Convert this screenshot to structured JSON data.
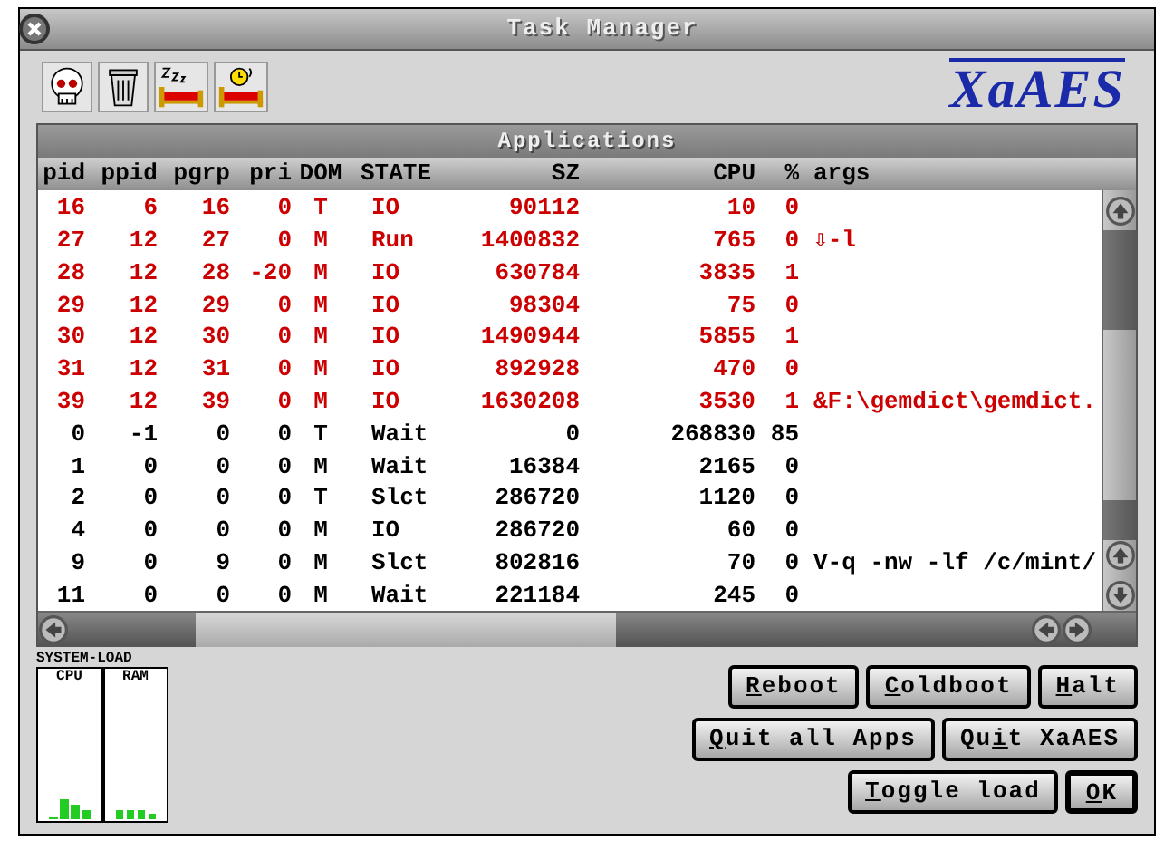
{
  "window": {
    "title": "Task Manager"
  },
  "logo": "XaAES",
  "panel": {
    "title": "Applications",
    "columns": [
      "pid",
      "ppid",
      "pgrp",
      "pri",
      "DOM",
      "STATE",
      "SZ",
      "CPU",
      "%",
      "args"
    ],
    "rows": [
      {
        "color": "#cc0000",
        "pid": "16",
        "ppid": "6",
        "pgrp": "16",
        "pri": "0",
        "dom": "T",
        "state": "IO",
        "sz": "90112",
        "cpu": "10",
        "pct": "0"
      },
      {
        "color": "#cc0000",
        "pid": "27",
        "ppid": "12",
        "pgrp": "27",
        "pri": "0",
        "dom": "M",
        "state": "Run",
        "sz": "1400832",
        "cpu": "765",
        "pct": "0",
        "args": "⇩-l"
      },
      {
        "color": "#cc0000",
        "pid": "28",
        "ppid": "12",
        "pgrp": "28",
        "pri": "-20",
        "dom": "M",
        "state": "IO",
        "sz": "630784",
        "cpu": "3835",
        "pct": "1"
      },
      {
        "color": "#cc0000",
        "pid": "29",
        "ppid": "12",
        "pgrp": "29",
        "pri": "0",
        "dom": "M",
        "state": "IO",
        "sz": "98304",
        "cpu": "75",
        "pct": "0"
      },
      {
        "color": "#cc0000",
        "pid": "30",
        "ppid": "12",
        "pgrp": "30",
        "pri": "0",
        "dom": "M",
        "state": "IO",
        "sz": "1490944",
        "cpu": "5855",
        "pct": "1"
      },
      {
        "color": "#cc0000",
        "pid": "31",
        "ppid": "12",
        "pgrp": "31",
        "pri": "0",
        "dom": "M",
        "state": "IO",
        "sz": "892928",
        "cpu": "470",
        "pct": "0"
      },
      {
        "color": "#cc0000",
        "pid": "39",
        "ppid": "12",
        "pgrp": "39",
        "pri": "0",
        "dom": "M",
        "state": "IO",
        "sz": "1630208",
        "cpu": "3530",
        "pct": "1",
        "args": "&F:\\gemdict\\gemdict."
      },
      {
        "color": "#000000",
        "pid": "0",
        "ppid": "-1",
        "pgrp": "0",
        "pri": "0",
        "dom": "T",
        "state": "Wait",
        "sz": "0",
        "cpu": "268830",
        "pct": "85"
      },
      {
        "color": "#000000",
        "pid": "1",
        "ppid": "0",
        "pgrp": "0",
        "pri": "0",
        "dom": "M",
        "state": "Wait",
        "sz": "16384",
        "cpu": "2165",
        "pct": "0"
      },
      {
        "color": "#000000",
        "pid": "2",
        "ppid": "0",
        "pgrp": "0",
        "pri": "0",
        "dom": "T",
        "state": "Slct",
        "sz": "286720",
        "cpu": "1120",
        "pct": "0"
      },
      {
        "color": "#000000",
        "pid": "4",
        "ppid": "0",
        "pgrp": "0",
        "pri": "0",
        "dom": "M",
        "state": "IO",
        "sz": "286720",
        "cpu": "60",
        "pct": "0"
      },
      {
        "color": "#000000",
        "pid": "9",
        "ppid": "0",
        "pgrp": "9",
        "pri": "0",
        "dom": "M",
        "state": "Slct",
        "sz": "802816",
        "cpu": "70",
        "pct": "0",
        "args": "V-q -nw -lf /c/mint/"
      },
      {
        "color": "#000000",
        "pid": "11",
        "ppid": "0",
        "pgrp": "0",
        "pri": "0",
        "dom": "M",
        "state": "Wait",
        "sz": "221184",
        "cpu": "245",
        "pct": "0"
      }
    ]
  },
  "system_load": {
    "title": "SYSTEM-LOAD",
    "columns": [
      "CPU",
      "RAM"
    ]
  },
  "button_rows": [
    [
      {
        "parts": [
          {
            "text": "R",
            "underlined": true
          },
          {
            "text": "eboot",
            "underlined": false
          }
        ],
        "default": false
      },
      {
        "parts": [
          {
            "text": "C",
            "underlined": true
          },
          {
            "text": "oldboot",
            "underlined": false
          }
        ],
        "default": false
      },
      {
        "parts": [
          {
            "text": "H",
            "underlined": true
          },
          {
            "text": "alt",
            "underlined": false
          }
        ],
        "default": false
      }
    ],
    [
      {
        "parts": [
          {
            "text": "Q",
            "underlined": true
          },
          {
            "text": "uit all Apps",
            "underlined": false
          }
        ],
        "default": false
      },
      {
        "parts": [
          {
            "text": "Qu",
            "underlined": false
          },
          {
            "text": "i",
            "underlined": true
          },
          {
            "text": "t XaAES",
            "underlined": false
          }
        ],
        "default": false
      }
    ],
    [
      {
        "parts": [
          {
            "text": "T",
            "underlined": true
          },
          {
            "text": "oggle load",
            "underlined": false
          }
        ],
        "default": false
      },
      {
        "parts": [
          {
            "text": "O",
            "underlined": true
          },
          {
            "text": "K",
            "underlined": false
          }
        ],
        "default": true
      }
    ]
  ]
}
